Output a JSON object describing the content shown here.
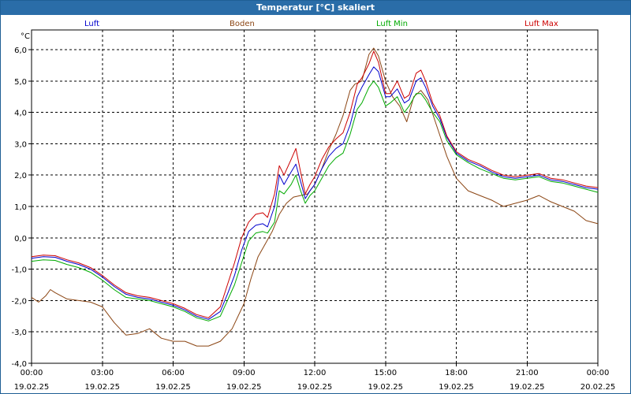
{
  "chart_data": {
    "type": "line",
    "title": "Temperatur [°C] skaliert",
    "ylabel": "°C",
    "ylim": [
      -4.0,
      6.5
    ],
    "yticks": [
      "6,0",
      "5,0",
      "4,0",
      "3,0",
      "2,0",
      "1,0",
      "0,0",
      "-1,0",
      "-2,0",
      "-3,0",
      "-4,0"
    ],
    "xticks": [
      {
        "time": "00:00",
        "date": "19.02.25"
      },
      {
        "time": "03:00",
        "date": "19.02.25"
      },
      {
        "time": "06:00",
        "date": "19.02.25"
      },
      {
        "time": "09:00",
        "date": "19.02.25"
      },
      {
        "time": "12:00",
        "date": "19.02.25"
      },
      {
        "time": "15:00",
        "date": "19.02.25"
      },
      {
        "time": "18:00",
        "date": "19.02.25"
      },
      {
        "time": "21:00",
        "date": "19.02.25"
      },
      {
        "time": "00:00",
        "date": "20.02.25"
      }
    ],
    "xrange_hours": [
      0,
      24
    ],
    "grid": true,
    "legend_position": "top",
    "series": [
      {
        "name": "Luft",
        "color": "#0000cc",
        "points": [
          [
            0,
            -0.65
          ],
          [
            0.5,
            -0.6
          ],
          [
            1,
            -0.62
          ],
          [
            1.5,
            -0.75
          ],
          [
            2,
            -0.85
          ],
          [
            2.5,
            -1.0
          ],
          [
            3,
            -1.25
          ],
          [
            3.5,
            -1.55
          ],
          [
            4,
            -1.8
          ],
          [
            4.5,
            -1.9
          ],
          [
            5,
            -1.95
          ],
          [
            5.5,
            -2.05
          ],
          [
            6,
            -2.15
          ],
          [
            6.5,
            -2.3
          ],
          [
            7,
            -2.5
          ],
          [
            7.5,
            -2.6
          ],
          [
            8,
            -2.35
          ],
          [
            8.3,
            -1.8
          ],
          [
            8.6,
            -1.2
          ],
          [
            8.9,
            -0.4
          ],
          [
            9.2,
            0.2
          ],
          [
            9.5,
            0.4
          ],
          [
            9.8,
            0.45
          ],
          [
            10,
            0.35
          ],
          [
            10.3,
            1.0
          ],
          [
            10.5,
            2.0
          ],
          [
            10.7,
            1.7
          ],
          [
            11,
            2.1
          ],
          [
            11.2,
            2.35
          ],
          [
            11.4,
            1.8
          ],
          [
            11.6,
            1.25
          ],
          [
            11.8,
            1.5
          ],
          [
            12,
            1.7
          ],
          [
            12.3,
            2.2
          ],
          [
            12.6,
            2.6
          ],
          [
            12.9,
            2.85
          ],
          [
            13.2,
            3.0
          ],
          [
            13.5,
            3.6
          ],
          [
            13.8,
            4.5
          ],
          [
            14,
            4.8
          ],
          [
            14.3,
            5.2
          ],
          [
            14.5,
            5.45
          ],
          [
            14.7,
            5.3
          ],
          [
            15,
            4.5
          ],
          [
            15.2,
            4.5
          ],
          [
            15.5,
            4.75
          ],
          [
            15.8,
            4.3
          ],
          [
            16,
            4.4
          ],
          [
            16.3,
            5.0
          ],
          [
            16.5,
            5.1
          ],
          [
            16.7,
            4.8
          ],
          [
            17,
            4.2
          ],
          [
            17.3,
            3.8
          ],
          [
            17.6,
            3.2
          ],
          [
            18,
            2.7
          ],
          [
            18.5,
            2.45
          ],
          [
            19,
            2.3
          ],
          [
            19.5,
            2.1
          ],
          [
            20,
            1.95
          ],
          [
            20.5,
            1.9
          ],
          [
            21,
            1.95
          ],
          [
            21.5,
            2.0
          ],
          [
            22,
            1.85
          ],
          [
            22.5,
            1.8
          ],
          [
            23,
            1.7
          ],
          [
            23.5,
            1.6
          ],
          [
            24,
            1.55
          ]
        ]
      },
      {
        "name": "Boden",
        "color": "#8b4513",
        "points": [
          [
            0,
            -1.9
          ],
          [
            0.3,
            -2.05
          ],
          [
            0.6,
            -1.85
          ],
          [
            0.8,
            -1.65
          ],
          [
            1,
            -1.75
          ],
          [
            1.5,
            -1.95
          ],
          [
            2,
            -2.0
          ],
          [
            2.5,
            -2.05
          ],
          [
            3,
            -2.2
          ],
          [
            3.5,
            -2.7
          ],
          [
            4,
            -3.1
          ],
          [
            4.5,
            -3.05
          ],
          [
            5,
            -2.9
          ],
          [
            5.5,
            -3.2
          ],
          [
            6,
            -3.3
          ],
          [
            6.5,
            -3.3
          ],
          [
            7,
            -3.45
          ],
          [
            7.5,
            -3.45
          ],
          [
            8,
            -3.3
          ],
          [
            8.5,
            -2.9
          ],
          [
            9,
            -2.1
          ],
          [
            9.3,
            -1.3
          ],
          [
            9.6,
            -0.6
          ],
          [
            9.9,
            -0.2
          ],
          [
            10.2,
            0.2
          ],
          [
            10.5,
            0.75
          ],
          [
            10.8,
            1.1
          ],
          [
            11.1,
            1.3
          ],
          [
            11.4,
            1.35
          ],
          [
            11.7,
            1.4
          ],
          [
            12,
            1.7
          ],
          [
            12.3,
            2.2
          ],
          [
            12.6,
            2.8
          ],
          [
            12.9,
            3.3
          ],
          [
            13.2,
            3.9
          ],
          [
            13.5,
            4.7
          ],
          [
            13.7,
            4.9
          ],
          [
            14,
            5.0
          ],
          [
            14.3,
            5.85
          ],
          [
            14.5,
            6.05
          ],
          [
            14.7,
            5.8
          ],
          [
            15,
            5.0
          ],
          [
            15.3,
            4.5
          ],
          [
            15.6,
            4.2
          ],
          [
            15.9,
            3.7
          ],
          [
            16.2,
            4.5
          ],
          [
            16.5,
            4.7
          ],
          [
            16.8,
            4.4
          ],
          [
            17.2,
            3.5
          ],
          [
            17.6,
            2.6
          ],
          [
            18,
            1.9
          ],
          [
            18.5,
            1.5
          ],
          [
            19,
            1.35
          ],
          [
            19.5,
            1.2
          ],
          [
            20,
            1.0
          ],
          [
            20.5,
            1.1
          ],
          [
            21,
            1.2
          ],
          [
            21.5,
            1.35
          ],
          [
            22,
            1.15
          ],
          [
            22.5,
            1.0
          ],
          [
            23,
            0.85
          ],
          [
            23.5,
            0.55
          ],
          [
            24,
            0.45
          ]
        ]
      },
      {
        "name": "Luft Min",
        "color": "#00aa00",
        "points": [
          [
            0,
            -0.75
          ],
          [
            0.5,
            -0.7
          ],
          [
            1,
            -0.72
          ],
          [
            1.5,
            -0.85
          ],
          [
            2,
            -0.95
          ],
          [
            2.5,
            -1.1
          ],
          [
            3,
            -1.35
          ],
          [
            3.5,
            -1.65
          ],
          [
            4,
            -1.9
          ],
          [
            4.5,
            -1.95
          ],
          [
            5,
            -2.0
          ],
          [
            5.5,
            -2.1
          ],
          [
            6,
            -2.2
          ],
          [
            6.5,
            -2.35
          ],
          [
            7,
            -2.55
          ],
          [
            7.5,
            -2.65
          ],
          [
            8,
            -2.5
          ],
          [
            8.3,
            -2.0
          ],
          [
            8.6,
            -1.5
          ],
          [
            8.9,
            -0.8
          ],
          [
            9.2,
            -0.1
          ],
          [
            9.5,
            0.15
          ],
          [
            9.8,
            0.2
          ],
          [
            10,
            0.15
          ],
          [
            10.3,
            0.5
          ],
          [
            10.5,
            1.5
          ],
          [
            10.7,
            1.4
          ],
          [
            11,
            1.7
          ],
          [
            11.2,
            2.0
          ],
          [
            11.4,
            1.5
          ],
          [
            11.6,
            1.1
          ],
          [
            11.8,
            1.35
          ],
          [
            12,
            1.5
          ],
          [
            12.3,
            1.9
          ],
          [
            12.6,
            2.3
          ],
          [
            12.9,
            2.55
          ],
          [
            13.2,
            2.7
          ],
          [
            13.5,
            3.3
          ],
          [
            13.8,
            4.1
          ],
          [
            14,
            4.3
          ],
          [
            14.3,
            4.8
          ],
          [
            14.5,
            5.0
          ],
          [
            14.7,
            4.8
          ],
          [
            15,
            4.2
          ],
          [
            15.2,
            4.3
          ],
          [
            15.5,
            4.5
          ],
          [
            15.8,
            4.0
          ],
          [
            16,
            4.2
          ],
          [
            16.3,
            4.6
          ],
          [
            16.5,
            4.6
          ],
          [
            16.7,
            4.4
          ],
          [
            17,
            4.0
          ],
          [
            17.3,
            3.7
          ],
          [
            17.6,
            3.1
          ],
          [
            18,
            2.65
          ],
          [
            18.5,
            2.4
          ],
          [
            19,
            2.2
          ],
          [
            19.5,
            2.05
          ],
          [
            20,
            1.9
          ],
          [
            20.5,
            1.85
          ],
          [
            21,
            1.9
          ],
          [
            21.5,
            1.95
          ],
          [
            22,
            1.8
          ],
          [
            22.5,
            1.75
          ],
          [
            23,
            1.65
          ],
          [
            23.5,
            1.55
          ],
          [
            24,
            1.45
          ]
        ]
      },
      {
        "name": "Luft Max",
        "color": "#cc0000",
        "points": [
          [
            0,
            -0.6
          ],
          [
            0.5,
            -0.55
          ],
          [
            1,
            -0.57
          ],
          [
            1.5,
            -0.7
          ],
          [
            2,
            -0.8
          ],
          [
            2.5,
            -0.95
          ],
          [
            3,
            -1.2
          ],
          [
            3.5,
            -1.5
          ],
          [
            4,
            -1.75
          ],
          [
            4.5,
            -1.85
          ],
          [
            5,
            -1.9
          ],
          [
            5.5,
            -2.0
          ],
          [
            6,
            -2.1
          ],
          [
            6.5,
            -2.25
          ],
          [
            7,
            -2.45
          ],
          [
            7.5,
            -2.55
          ],
          [
            8,
            -2.2
          ],
          [
            8.3,
            -1.5
          ],
          [
            8.6,
            -0.8
          ],
          [
            8.9,
            0.0
          ],
          [
            9.2,
            0.5
          ],
          [
            9.5,
            0.75
          ],
          [
            9.8,
            0.8
          ],
          [
            10,
            0.65
          ],
          [
            10.3,
            1.4
          ],
          [
            10.5,
            2.3
          ],
          [
            10.7,
            2.0
          ],
          [
            11,
            2.5
          ],
          [
            11.2,
            2.85
          ],
          [
            11.4,
            2.1
          ],
          [
            11.6,
            1.4
          ],
          [
            11.8,
            1.7
          ],
          [
            12,
            1.95
          ],
          [
            12.3,
            2.5
          ],
          [
            12.6,
            2.9
          ],
          [
            12.9,
            3.15
          ],
          [
            13.2,
            3.35
          ],
          [
            13.5,
            4.0
          ],
          [
            13.8,
            4.9
          ],
          [
            14,
            5.1
          ],
          [
            14.3,
            5.55
          ],
          [
            14.5,
            5.95
          ],
          [
            14.7,
            5.6
          ],
          [
            15,
            4.6
          ],
          [
            15.2,
            4.6
          ],
          [
            15.5,
            5.0
          ],
          [
            15.8,
            4.45
          ],
          [
            16,
            4.55
          ],
          [
            16.3,
            5.25
          ],
          [
            16.5,
            5.35
          ],
          [
            16.7,
            5.0
          ],
          [
            17,
            4.3
          ],
          [
            17.3,
            3.9
          ],
          [
            17.6,
            3.25
          ],
          [
            18,
            2.75
          ],
          [
            18.5,
            2.5
          ],
          [
            19,
            2.35
          ],
          [
            19.5,
            2.15
          ],
          [
            20,
            2.0
          ],
          [
            20.5,
            1.95
          ],
          [
            21,
            2.0
          ],
          [
            21.5,
            2.05
          ],
          [
            22,
            1.9
          ],
          [
            22.5,
            1.85
          ],
          [
            23,
            1.75
          ],
          [
            23.5,
            1.65
          ],
          [
            24,
            1.6
          ]
        ]
      }
    ]
  }
}
